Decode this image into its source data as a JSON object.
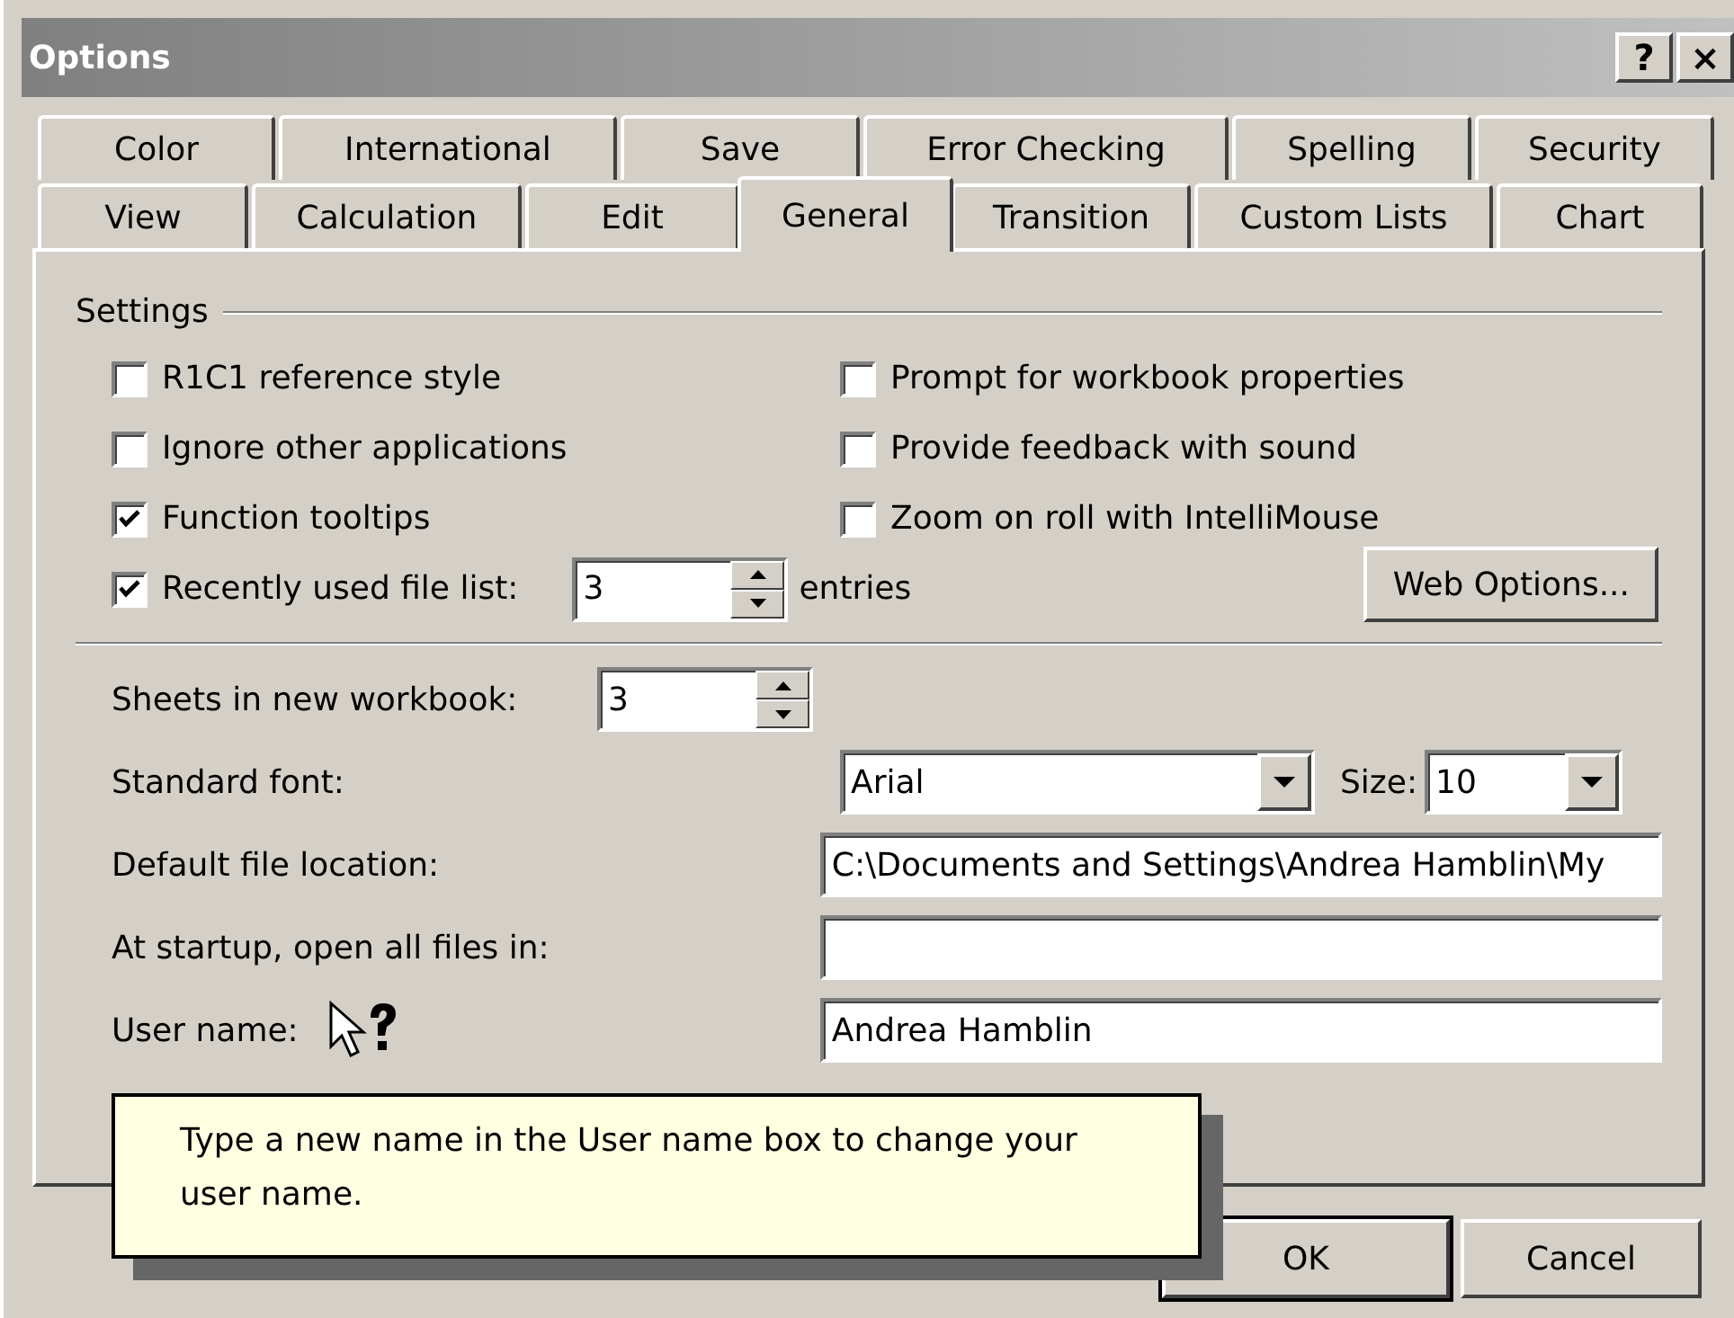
{
  "window": {
    "title": "Options",
    "title_buttons": [
      "?",
      "×"
    ]
  },
  "tab_rows": [
    [
      {
        "label": "Color",
        "selected": false
      },
      {
        "label": "International",
        "selected": false
      },
      {
        "label": "Save",
        "selected": false
      },
      {
        "label": "Error Checking",
        "selected": false
      },
      {
        "label": "Spelling",
        "selected": false
      },
      {
        "label": "Security",
        "selected": false
      }
    ],
    [
      {
        "label": "View",
        "selected": false
      },
      {
        "label": "Calculation",
        "selected": false
      },
      {
        "label": "Edit",
        "selected": false
      },
      {
        "label": "General",
        "selected": true
      },
      {
        "label": "Transition",
        "selected": false
      },
      {
        "label": "Custom Lists",
        "selected": false
      },
      {
        "label": "Chart",
        "selected": false
      }
    ]
  ],
  "settings": {
    "title": "Settings",
    "left": [
      {
        "label": "R1C1 reference style",
        "checked": false
      },
      {
        "label": "Ignore other applications",
        "checked": false
      },
      {
        "label": "Function tooltips",
        "checked": true
      },
      {
        "label": "Recently used file list:",
        "checked": true
      }
    ],
    "right": [
      {
        "label": "Prompt for workbook properties",
        "checked": false
      },
      {
        "label": "Provide feedback with sound",
        "checked": false
      },
      {
        "label": "Zoom on roll with IntelliMouse",
        "checked": false
      }
    ],
    "recent_count": "3",
    "recent_unit": "entries",
    "web_options": "Web Options..."
  },
  "sheets": {
    "label": "Sheets in new workbook:",
    "value": "3"
  },
  "font": {
    "label": "Standard font:",
    "value": "Arial",
    "size_label": "Size:",
    "size_value": "10"
  },
  "location": {
    "label": "Default file location:",
    "value": "C:\\Documents and Settings\\Andrea Hamblin\\My"
  },
  "startup": {
    "label": "At startup, open all files in:"
  },
  "user": {
    "label": "User name:",
    "value": "Andrea Hamblin"
  },
  "tooltip": "Type a new name in the User name box to change your user name.",
  "buttons": [
    {
      "label": "OK",
      "default": true
    },
    {
      "label": "Cancel",
      "default": false
    }
  ]
}
